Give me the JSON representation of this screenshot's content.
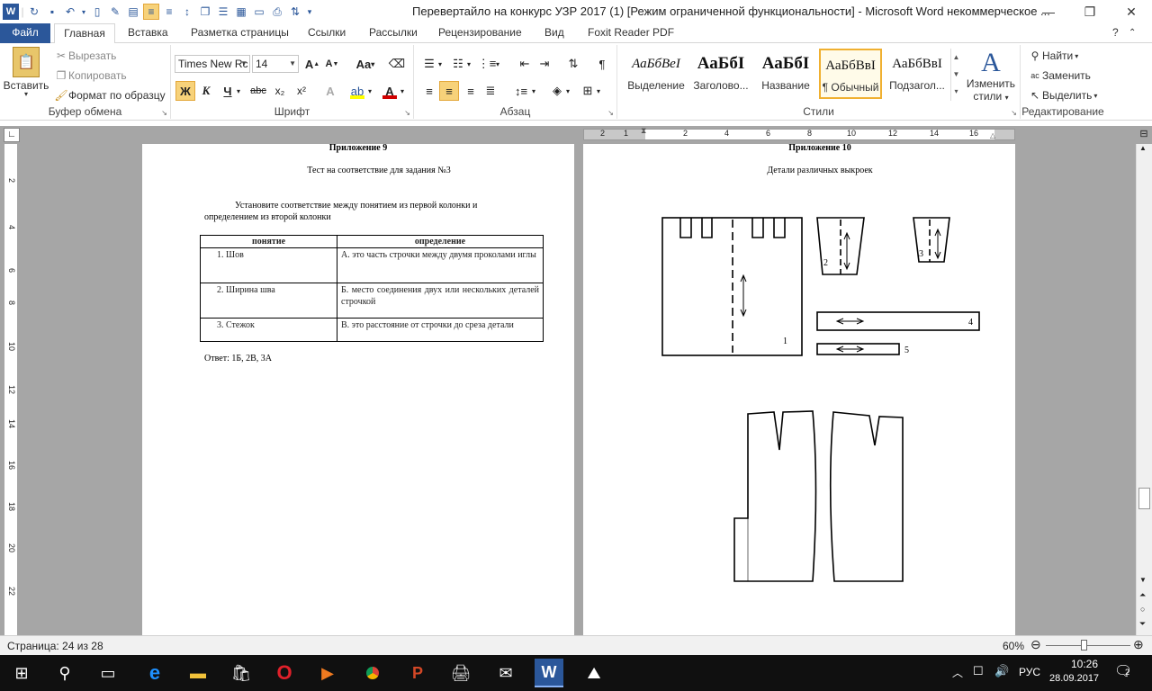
{
  "window": {
    "title": "Перевертайло на конкурс УЗР 2017 (1) [Режим ограниченной функциональности]  -  Microsoft Word некоммерческое ...",
    "minimize": "—",
    "restore": "❐",
    "close": "✕"
  },
  "tabs": {
    "file": "Файл",
    "items": [
      "Главная",
      "Вставка",
      "Разметка страницы",
      "Ссылки",
      "Рассылки",
      "Рецензирование",
      "Вид",
      "Foxit Reader PDF"
    ]
  },
  "clipboard": {
    "paste": "Вставить",
    "cut": "Вырезать",
    "copy": "Копировать",
    "format_painter": "Формат по образцу",
    "label": "Буфер обмена"
  },
  "font": {
    "name": "Times New Rc",
    "size": "14",
    "label": "Шрифт",
    "bold": "Ж",
    "italic": "К",
    "underline": "Ч",
    "strike": "abc",
    "sub": "x₂",
    "sup": "x²",
    "grow": "A",
    "shrink": "A",
    "case": "Aa",
    "color_a": "A"
  },
  "paragraph": {
    "label": "Абзац"
  },
  "styles": {
    "label": "Стили",
    "items": [
      {
        "preview": "АаБбВеI",
        "name": "Выделение"
      },
      {
        "preview": "АаБбI",
        "name": "Заголово..."
      },
      {
        "preview": "АаБбI",
        "name": "Название"
      },
      {
        "preview": "АаБбВвI",
        "name": "¶ Обычный"
      },
      {
        "preview": "АаБбВвI",
        "name": "Подзагол..."
      }
    ],
    "change_line1": "Изменить",
    "change_line2": "стили"
  },
  "editing": {
    "label": "Редактирование",
    "find": "Найти",
    "replace": "Заменить",
    "select": "Выделить"
  },
  "ruler": {
    "h_numbers": [
      "2",
      "1",
      "2",
      "4",
      "6",
      "8",
      "10",
      "12",
      "14",
      "16"
    ],
    "v_numbers": [
      "2",
      "4",
      "6",
      "8",
      "10",
      "12",
      "14",
      "16",
      "18",
      "20",
      "22"
    ]
  },
  "page_left": {
    "heading": "Приложение 9",
    "subtitle": "Тест на соответствие для задания №3",
    "instruction_1": "Установите соответствие между понятием из первой колонки и",
    "instruction_2": "определением из второй колонки",
    "table": {
      "headers": [
        "понятие",
        "определение"
      ],
      "rows": [
        {
          "term": "1. Шов",
          "def": "А. это часть строчки между двумя проколами иглы"
        },
        {
          "term": "2. Ширина шва",
          "def": "Б. место соединения двух или нескольких деталей строчкой"
        },
        {
          "term": "3. Стежок",
          "def": "В. это расстояние от строчки до среза детали"
        }
      ]
    },
    "answer": "Ответ: 1Б, 2В, 3А"
  },
  "page_right": {
    "heading": "Приложение 10",
    "subtitle": "Детали различных выкроек",
    "piece_labels": [
      "1",
      "2",
      "3",
      "4",
      "5"
    ]
  },
  "status": {
    "page": "Страница: 24 из 28",
    "zoom": "60%",
    "zoom_fraction": 0.45
  },
  "taskbar": {
    "lang": "РУС",
    "time": "10:26",
    "date": "28.09.2017",
    "notifications": "2"
  }
}
